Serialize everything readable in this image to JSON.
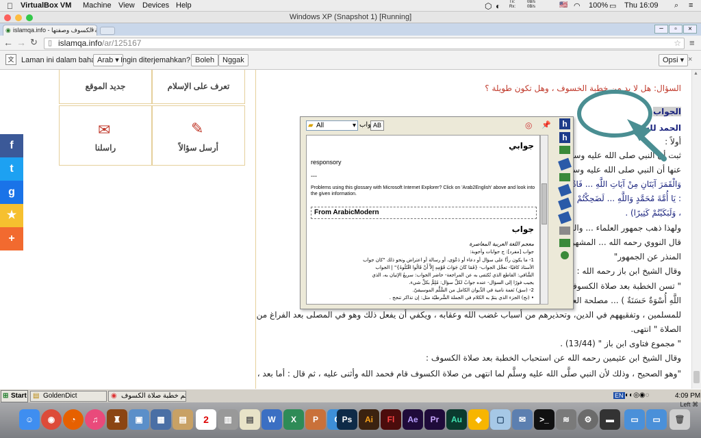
{
  "mac_menu": {
    "app": "VirtualBox VM",
    "items": [
      "Machine",
      "View",
      "Devices",
      "Help"
    ],
    "net_tx": "Tx:",
    "net_rx": "Rx:",
    "tx_val": "0B/s",
    "rx_val": "0B/s",
    "battery": "100%",
    "clock": "Thu 16:09"
  },
  "vbox_title": "Windows XP (Snapshot 1) [Running]",
  "browser": {
    "tab_title": "islamqa.info - خطبة الكسوف وصفتها",
    "url_host": "islamqa.info",
    "url_path": "/ar/125167"
  },
  "translate": {
    "prompt": "Laman ini dalam bahasa",
    "lang": "Arab",
    "question": "Ingin diterjemahkan?",
    "yes": "Boleh",
    "no": "Nggak",
    "options": "Opsi"
  },
  "tiles": [
    {
      "label": "جديد الموقع"
    },
    {
      "label": "تعرف على الإسلام"
    },
    {
      "label": "راسلنا"
    },
    {
      "label": "أرسل سؤالاً"
    }
  ],
  "article": {
    "question": "السؤال: هل لا بد من خطبة الخسوف ، وهل تكون طويلة ؟",
    "answer_word": "الجواب",
    "praise": "الحمد لله",
    "lines": [
      "أولاً :",
      "ثبت أن النبي صلى الله عليه وسلم خطب في الكسوف ... عائشة رضي الله",
      "عنها أن النبي صلى الله عليه وسلم ... فقال : (إِنَّ الشَّمْسَ",
      "وَالْقَمَرَ آيَتَانِ مِنْ آيَاتِ اللَّهِ ... فَادْعُوا اللَّهَ وَكَبِّرُوا وَصَلُّوا وَتَصَدَّقُوا ، ثُمَّ قَالَ",
      ": يَا أُمَّةَ مُحَمَّدٍ وَاللَّهِ ... لَضَحِكْتُمْ قَلِيلًا",
      "، وَلَبَكَيْتُمْ كَثِيرًا) .",
      "ولهذا ذهب جمهور العلماء ... والشافعي والإمام أحمد .",
      "قال النووي رحمه الله ... المشهورة ، ونقله ابن",
      "المنذر عن الجمهور\"",
      "وقال الشيخ ابن باز رحمه الله :",
      "\" تسن الخطبة بعد صلاة الكسوف ... ولكم في رسول",
      "اللَّهِ أُسْوَةٌ حَسَنَةٌ ) ... مصلحة العامة",
      "للمسلمين ، وتفقيههم في الدين، وتحذيرهم من أسباب غضب الله وعقابه ، ويكفي أن يفعل ذلك وهو في المصلى بعد الفراغ من",
      "الصلاة \" انتهى.",
      "\" مجموع فتاوى ابن باز \" (13/44) .",
      "وقال الشيخ ابن عثيمين رحمه الله عن استحباب الخطبة بعد صلاة الكسوف :",
      "\"وهو الصحيح ، وذلك لأن النبي صلَّى الله عليه وسلَّم لما انتهى من صلاة الكسوف قام فحمد الله وأثنى عليه ، ثم قال : أما بعد ،"
    ]
  },
  "dict": {
    "select_value": "All",
    "word_label": "جواب",
    "ab_btn": "AB",
    "headword1": "جوابي",
    "gloss": "responsory",
    "sep": "---",
    "problem": "Problems using this glossary with Microsoft Internet Explorer? Click on 'Arab2English' above and look into the given information.",
    "section": "From ArabicModern",
    "headword2": "جواب",
    "source": "معجم اللغة العربية المعاصرة",
    "def": [
      "جواب [مفرد]: ج جوابات وأجوبة:",
      "1- ما يكون ردًّا على سؤال أو دعاء أو دَعْوَى، أو رسالة أو اعتراض ونحو ذلك \"كان جواب",
      "الأستاذ كافيًا- تعجَّل الجواب- {فَمَا كَانَ جَوَابَ قَوْمِهِ إِلاَّ أَنْ قَالُوا اقْتُلُوهُ}\" | الجواب",
      "الشَّافي: القاطع الذي تُكتفى به عن المراجعة- حاضر الجواب: سريعُ الإتيان به، الذي",
      "يجيب فورًا إلى السؤال- عنده جوابٌ لكلِّ سؤال: مُلِمٌّ بكلِّ شيء.",
      "2- (سق) نَغمة نامية في الدِّيوان الكامل من السُّلَّم الموسيقيّ.",
      "• (نح) الجزء الذي يتمّ به الكلام في الجملة الشَّرطيّة مثل: إن تذاكر تنجح ."
    ]
  },
  "taskbar": {
    "start": "Start",
    "items": [
      "GoldenDict",
      "حكم خطبة صلاة الكسوف ..."
    ],
    "lang": "EN",
    "time": "4:09 PM"
  },
  "vbox_status": {
    "host_key": "Left ⌘"
  },
  "dock_apps": [
    "Finder",
    "Chrome",
    "Firefox",
    "iTunes",
    "Alfred",
    "Preview",
    "Notes",
    "Calendar",
    "Books",
    "Notes2",
    "Word",
    "Excel",
    "Photoshop",
    "Illustrator",
    "Flash",
    "After Effects",
    "Premiere",
    "Audition",
    "Sketch",
    "VirtualBox",
    "Terminal",
    "Prefs",
    "Trash"
  ],
  "colors": {
    "chrome_blue": "#c9d7ea",
    "gold": "#e5cf9a",
    "question_red": "#c0392b",
    "text_blue": "#1a237e",
    "arrow_teal": "#4a8e92"
  }
}
